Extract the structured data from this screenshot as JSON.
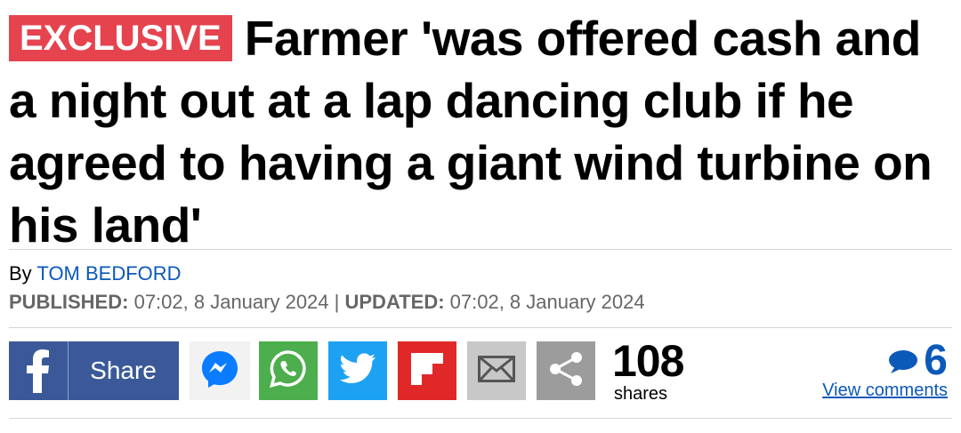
{
  "article": {
    "badge": "EXCLUSIVE",
    "headline": "Farmer 'was offered cash and a night out at a lap dancing club if he agreed to having a giant wind turbine on his land'",
    "byline_prefix": "By",
    "author": "TOM BEDFORD",
    "published_label": "PUBLISHED:",
    "published_value": "07:02, 8 January 2024",
    "separator": "|",
    "updated_label": "UPDATED:",
    "updated_value": "07:02, 8 January 2024"
  },
  "share": {
    "facebook_label": "Share",
    "icons": [
      "facebook-icon",
      "messenger-icon",
      "whatsapp-icon",
      "twitter-icon",
      "flipboard-icon",
      "email-icon",
      "share-icon"
    ],
    "count": "108",
    "count_label": "shares"
  },
  "comments": {
    "count": "6",
    "link_label": "View comments"
  },
  "colors": {
    "badge": "#e5444f",
    "link": "#0b59b8",
    "facebook": "#3b5998",
    "whatsapp": "#4cae4c",
    "twitter": "#1da1f2",
    "flipboard": "#e12828",
    "email": "#c8c8c8",
    "share": "#9c9c9c"
  }
}
